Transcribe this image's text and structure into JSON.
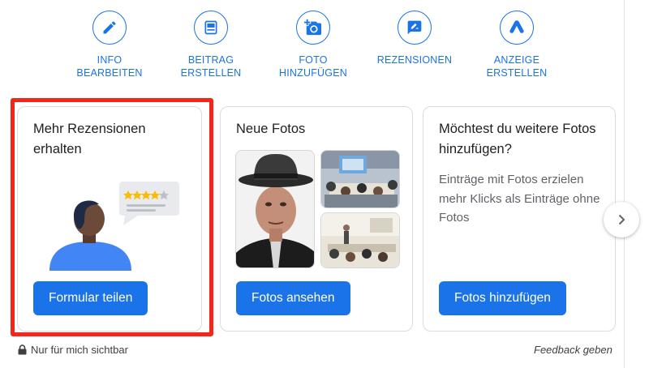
{
  "actions": [
    {
      "label": "INFO\nBEARBEITEN",
      "icon": "pencil-icon"
    },
    {
      "label": "BEITRAG\nERSTELLEN",
      "icon": "post-icon"
    },
    {
      "label": "FOTO\nHINZUFÜGEN",
      "icon": "add-photo-icon"
    },
    {
      "label": "REZENSIONEN",
      "icon": "review-icon"
    },
    {
      "label": "ANZEIGE\nERSTELLEN",
      "icon": "ads-icon"
    }
  ],
  "cards": {
    "reviews": {
      "title": "Mehr Rezensionen erhalten",
      "button": "Formular teilen"
    },
    "photos": {
      "title": "Neue Fotos",
      "button": "Fotos ansehen"
    },
    "add_photos": {
      "title": "Möchtest du weitere Fotos hinzufügen?",
      "description": "Einträge mit Fotos erzielen mehr Klicks als Einträge ohne Fotos",
      "button": "Fotos hinzufügen"
    }
  },
  "footer": {
    "visibility": "Nur für mich sichtbar",
    "feedback": "Feedback geben"
  },
  "colors": {
    "accent": "#1a73e8",
    "highlight": "#f4261a"
  }
}
